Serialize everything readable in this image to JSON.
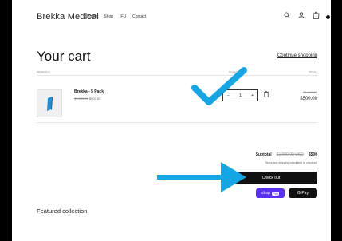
{
  "header": {
    "brand": "Brekka Medical",
    "nav": [
      "Home",
      "Shop",
      "IFU",
      "Contact"
    ],
    "icons": [
      "search-icon",
      "account-icon",
      "cart-icon"
    ]
  },
  "cart": {
    "title": "Your cart",
    "continue_label": "Continue shopping",
    "columns": {
      "product": "PRODUCT",
      "quantity": "QUANTITY",
      "total": "TOTAL"
    },
    "item": {
      "name": "Brekka - 5 Pack",
      "price_old": "$1,000.00",
      "price_new": "$500.00",
      "quantity": "1",
      "minus": "−",
      "plus": "+",
      "total_old": "$1,000.00",
      "total_new": "$500.00"
    }
  },
  "summary": {
    "subtotal_label": "Subtotal",
    "subtotal_old": "$1,000.00 USD",
    "subtotal_new": "$500",
    "taxes_note": "Taxes and shipping calculated at checkout",
    "checkout_label": "Check out",
    "shoppay_label": "shop",
    "shoppay_badge": "Pay",
    "gpay_label": "G Pay"
  },
  "featured": {
    "title": "Featured collection"
  },
  "colors": {
    "accent_arrow": "#15a6e6",
    "checkout_bg": "#111111",
    "shoppay_bg": "#5a31f4"
  }
}
